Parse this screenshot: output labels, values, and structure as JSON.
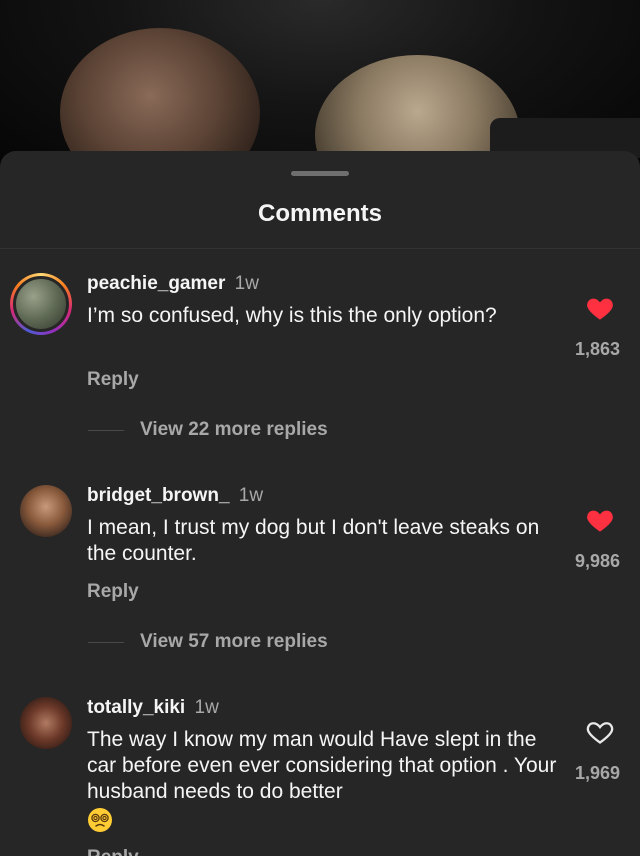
{
  "sheet": {
    "title": "Comments"
  },
  "comments": [
    {
      "username": "peachie_gamer",
      "time": "1w",
      "text": "I’m so confused, why is this the only option?",
      "likes": "1,863",
      "liked": true,
      "reply_label": "Reply",
      "view_replies": "View 22 more replies"
    },
    {
      "username": "bridget_brown_",
      "time": "1w",
      "text": "I mean, I trust my dog but I don't leave steaks on the counter.",
      "likes": "9,986",
      "liked": true,
      "reply_label": "Reply",
      "view_replies": "View 57 more replies"
    },
    {
      "username": "totally_kiki",
      "time": "1w",
      "text": "The way I know my man would Have slept in the car before even ever considering that option . Your husband needs to do better",
      "likes": "1,969",
      "liked": false,
      "reply_label": "Reply"
    }
  ],
  "colors": {
    "liked_heart": "#ff3040",
    "sheet_bg": "#262626",
    "muted_text": "#a8a8a8"
  }
}
